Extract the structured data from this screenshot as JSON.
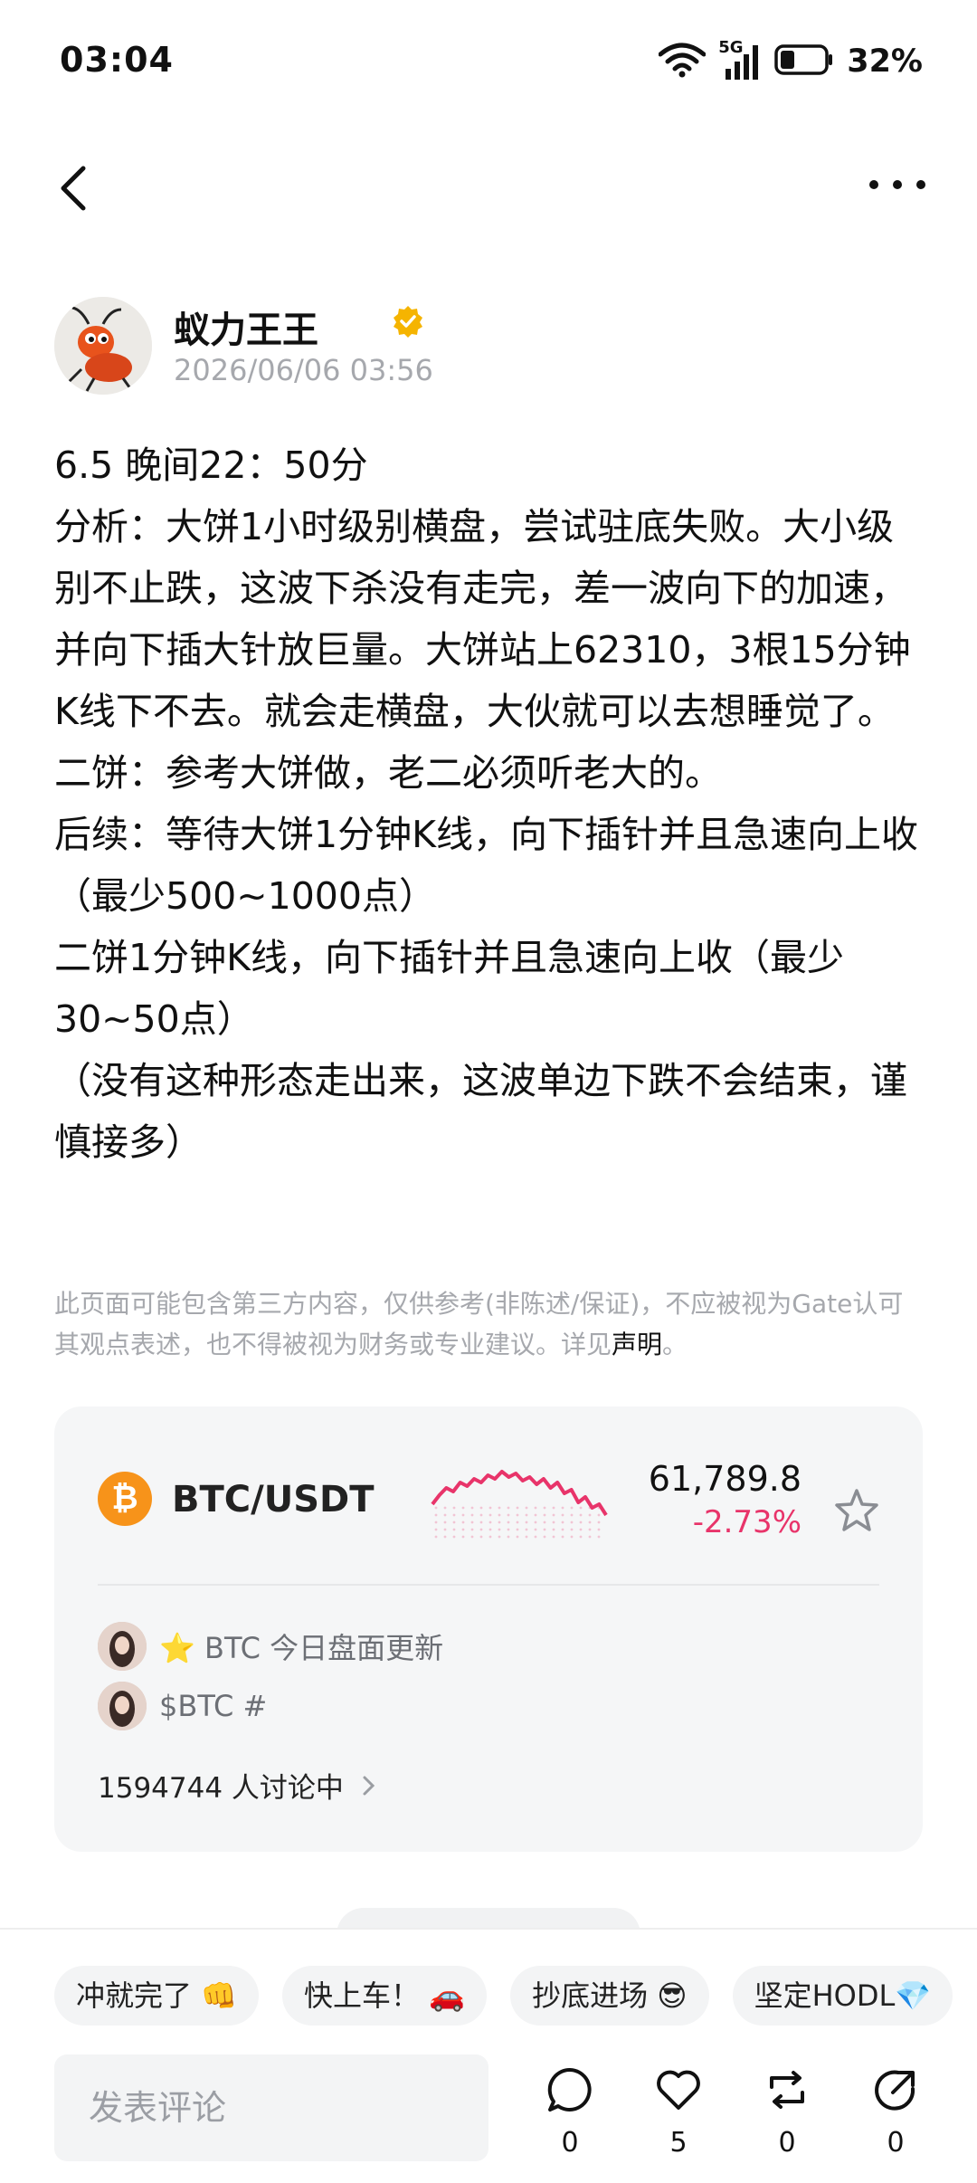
{
  "status_bar": {
    "time": "03:04",
    "network": "5G",
    "battery_percent": "32%",
    "battery_level": 0.32
  },
  "post": {
    "author": {
      "name": "蚁力王王",
      "verified": true
    },
    "timestamp": "2026/06/06 03:56",
    "lines": [
      "6.5  晚间22：50分",
      "分析：大饼1小时级别横盘，尝试驻底失败。大小级别不止跌，这波下杀没有走完，差一波向下的加速，并向下插大针放巨量。大饼站上62310，3根15分钟K线下不去。就会走横盘，大伙就可以去想睡觉了。",
      "二饼：参考大饼做，老二必须听老大的。",
      "后续：等待大饼1分钟K线，向下插针并且急速向上收（最少500~1000点）",
      "二饼1分钟K线，向下插针并且急速向上收（最少30~50点）",
      "（没有这种形态走出来，这波单边下跌不会结束，谨慎接多）"
    ]
  },
  "disclaimer": {
    "text": "此页面可能包含第三方内容，仅供参考(非陈述/保证)，不应被视为Gate认可其观点表述，也不得被视为财务或专业建议。详见",
    "link": "声明",
    "end": "。"
  },
  "market_card": {
    "pair": "BTC/USDT",
    "price": "61,789.8",
    "change": "-2.73%",
    "sparkline_color": "#e8346a",
    "topics": [
      {
        "text": "⭐ BTC 今日盘面更新"
      },
      {
        "text": "$BTC #"
      }
    ],
    "discussion": "1594744 人讨论中"
  },
  "quick_replies": [
    "冲就完了 👊",
    "快上车！ 🚗",
    "抄底进场 😎",
    "坚定HODL💎"
  ],
  "comment_placeholder": "发表评论",
  "actions": {
    "comments": "0",
    "likes": "5",
    "reposts": "0",
    "shares": "0"
  },
  "colors": {
    "accent_red": "#e8346a",
    "btc_orange": "#f7931a",
    "verified_gold": "#f5b400"
  }
}
